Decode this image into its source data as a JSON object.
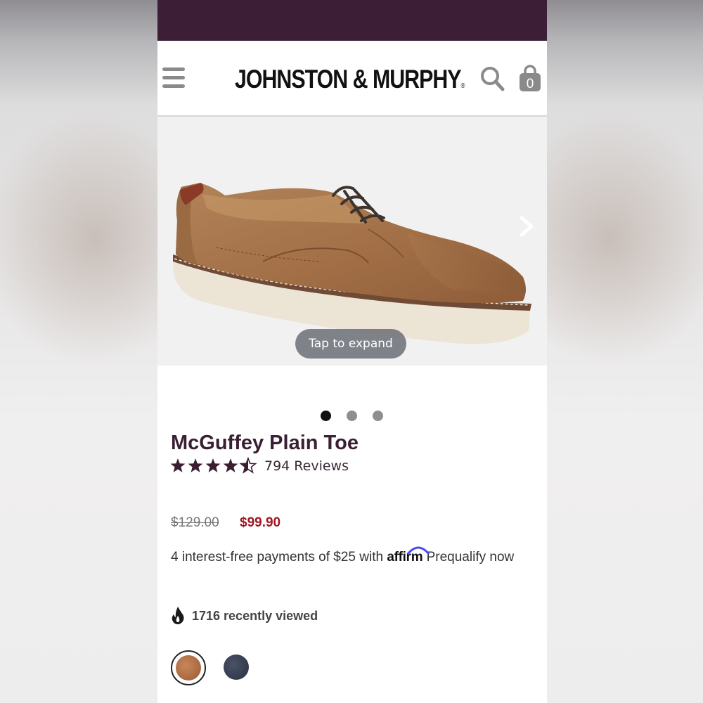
{
  "colors": {
    "top_band": "#3c1f36",
    "title": "#3a1f33",
    "sale_price": "#a01622",
    "dot_active": "#111111",
    "dot_inactive": "#8e8e8e",
    "swatch_tan": "#b06f45",
    "swatch_navy": "#363d50",
    "shoe_leather": "#a7764c"
  },
  "header": {
    "menu_icon": "hamburger-menu-icon",
    "logo_main": "JOHNSTON & MURPHY",
    "logo_mark": "®",
    "search_icon": "search-icon",
    "bag_icon": "shopping-bag-icon",
    "bag_count": "0"
  },
  "gallery": {
    "expand_label": "Tap to expand",
    "next_icon": "chevron-right-icon",
    "slide_count": 3,
    "active_slide": 1
  },
  "product": {
    "name": "McGuffey Plain Toe",
    "rating": 4.5,
    "reviews_label": "794 Reviews",
    "price_original": "$129.00",
    "price_sale": "$99.90",
    "installment_text": "4 interest-free payments of $25 with ",
    "affirm_logo": "affirm",
    "prequalify_text": " Prequalify now",
    "viewed_icon": "flame-icon",
    "viewed_text": "1716 recently viewed"
  },
  "swatches": [
    {
      "color": "tan",
      "selected": true
    },
    {
      "color": "navy",
      "selected": false
    }
  ]
}
